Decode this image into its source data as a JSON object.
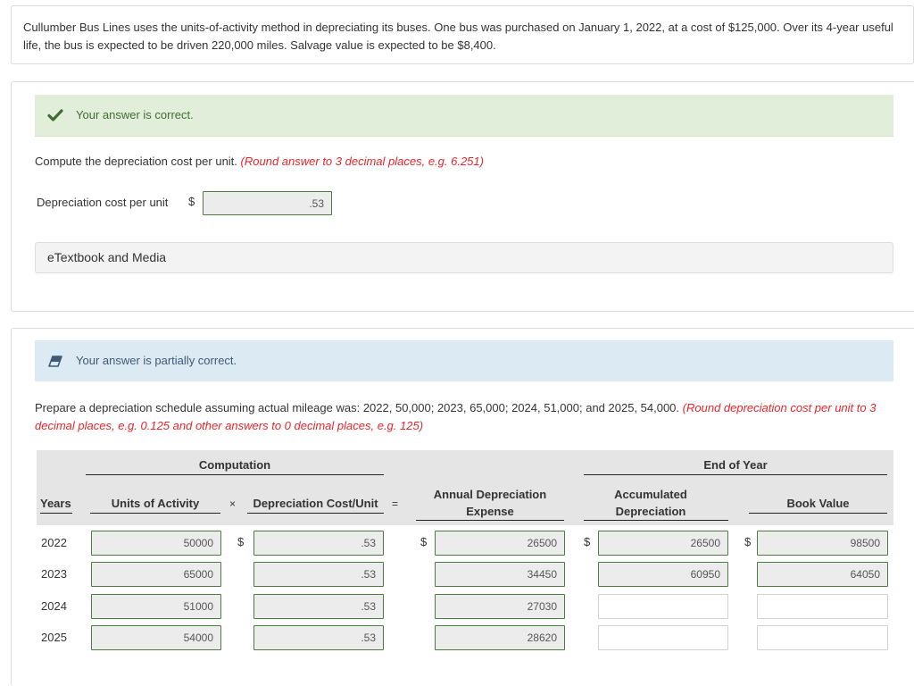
{
  "problem": {
    "text": "Cullumber Bus Lines uses the units-of-activity method in depreciating its buses. One bus was purchased on January 1, 2022, at a cost of $125,000. Over its 4-year useful life, the bus is expected to be driven 220,000 miles. Salvage value is expected to be $8,400."
  },
  "part1": {
    "status": {
      "text": "Your answer is correct.",
      "icon": "checkmark-icon",
      "color": "#3f6d34"
    },
    "instruction": "Compute the depreciation cost per unit.",
    "hint": "(Round answer to 3 decimal places, e.g. 6.251)",
    "field_label": "Depreciation cost per unit",
    "currency": "$",
    "value": ".53",
    "etextbook_label": "eTextbook and Media"
  },
  "part2": {
    "status": {
      "text": "Your answer is partially correct.",
      "icon": "eraser-icon",
      "color": "#3d5a76"
    },
    "instruction": "Prepare a depreciation schedule assuming actual mileage was: 2022, 50,000; 2023, 65,000; 2024, 51,000; and 2025, 54,000.",
    "hint_line1": "(Round depreciation cost per unit to 3",
    "hint_line2": "decimal places, e.g. 0.125 and other answers to 0 decimal places, e.g. 125)",
    "table": {
      "group_computation": "Computation",
      "group_end_of_year": "End of Year",
      "col_years": "Years",
      "col_units": "Units of Activity",
      "op_times": "×",
      "col_cost_unit": "Depreciation Cost/Unit",
      "op_equals": "=",
      "col_annual_line1": "Annual Depreciation",
      "col_annual_line2": "Expense",
      "col_accum_line1": "Accumulated",
      "col_accum_line2": "Depreciation",
      "col_book": "Book Value",
      "currency": "$",
      "rows": [
        {
          "year": "2022",
          "units": "50000",
          "cost_unit": ".53",
          "annual": "26500",
          "accumulated": "26500",
          "book": "98500"
        },
        {
          "year": "2023",
          "units": "65000",
          "cost_unit": ".53",
          "annual": "34450",
          "accumulated": "60950",
          "book": "64050"
        },
        {
          "year": "2024",
          "units": "51000",
          "cost_unit": ".53",
          "annual": "27030",
          "accumulated": "",
          "book": ""
        },
        {
          "year": "2025",
          "units": "54000",
          "cost_unit": ".53",
          "annual": "28620",
          "accumulated": "",
          "book": ""
        }
      ]
    }
  }
}
